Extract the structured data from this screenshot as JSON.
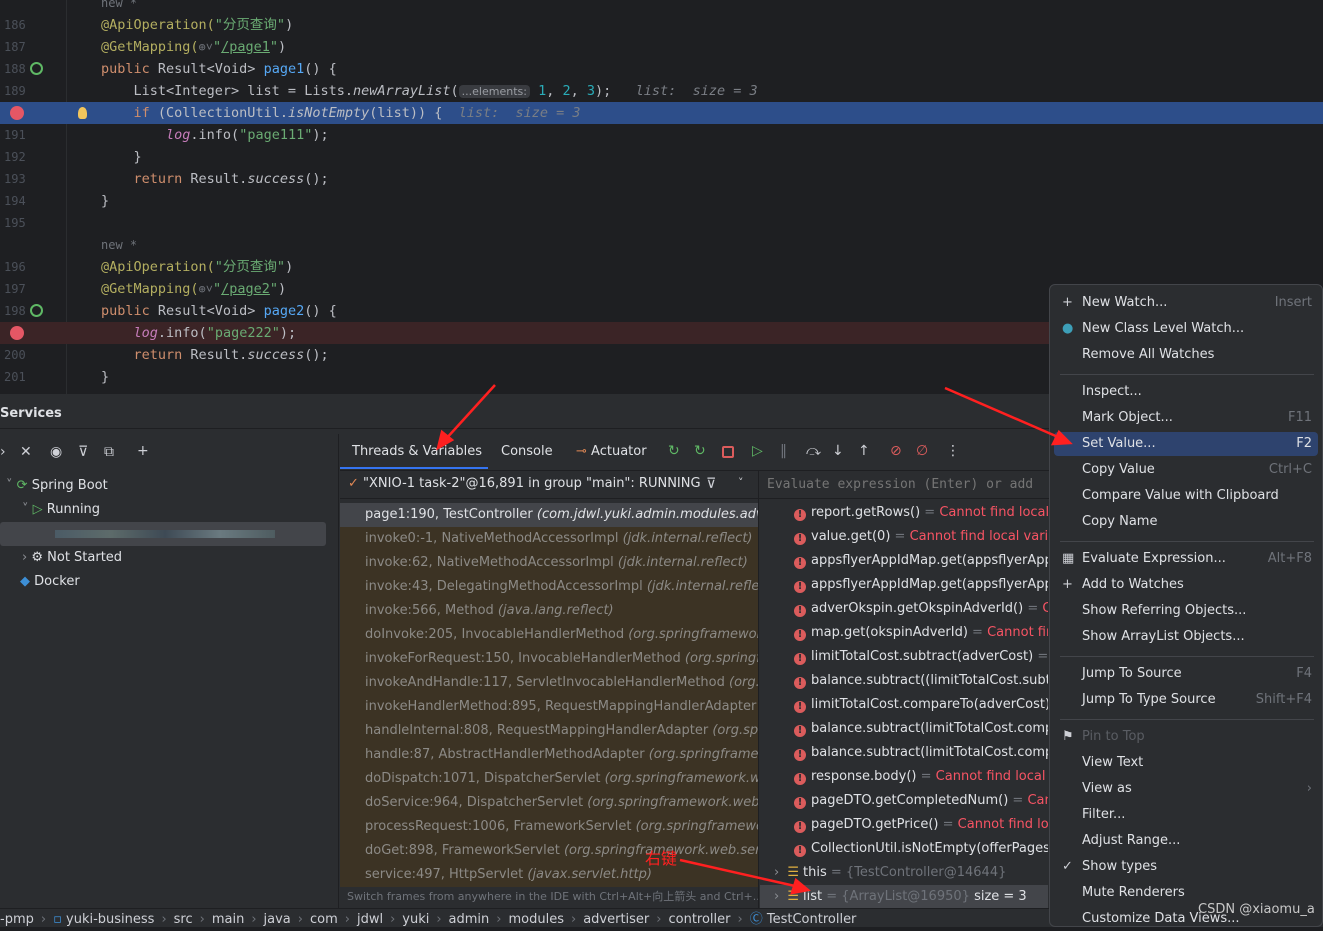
{
  "editor": {
    "lines": [
      {
        "n": "",
        "cls": "",
        "tokens": [
          {
            "t": "new *",
            "c": "g"
          }
        ]
      },
      {
        "n": "186",
        "cls": "",
        "tokens": [
          {
            "t": "@ApiOperation(",
            "c": "a"
          },
          {
            "t": "\"分页查询\"",
            "c": "s"
          },
          {
            "t": ")",
            "c": "t"
          }
        ]
      },
      {
        "n": "187",
        "cls": "",
        "tokens": [
          {
            "t": "@GetMapping(",
            "c": "a"
          },
          {
            "t": "⊕˅",
            "c": "g"
          },
          {
            "t": "\"",
            "c": "s"
          },
          {
            "t": "/page1",
            "c": "u"
          },
          {
            "t": "\"",
            "c": "s"
          },
          {
            "t": ")",
            "c": "t"
          }
        ]
      },
      {
        "n": "188",
        "cls": "spring",
        "tokens": [
          {
            "t": "public ",
            "c": "k"
          },
          {
            "t": "Result<Void> ",
            "c": "t"
          },
          {
            "t": "page1",
            "c": "f"
          },
          {
            "t": "() {",
            "c": "t"
          }
        ]
      },
      {
        "n": "189",
        "cls": "",
        "tokens": [
          {
            "t": "    List<Integer> list = Lists.",
            "c": "t"
          },
          {
            "t": "newArrayList",
            "c": "t i"
          },
          {
            "t": "(",
            "c": "t"
          },
          {
            "t": "...elements:",
            "c": "hint"
          },
          {
            "t": " 1",
            "c": "n"
          },
          {
            "t": ", ",
            "c": "t"
          },
          {
            "t": "2",
            "c": "n"
          },
          {
            "t": ", ",
            "c": "t"
          },
          {
            "t": "3",
            "c": "n"
          },
          {
            "t": ");   ",
            "c": "t"
          },
          {
            "t": "list:  size = 3",
            "c": "h"
          }
        ]
      },
      {
        "n": "",
        "cls": "hl",
        "tokens": [
          {
            "t": "    if ",
            "c": "k"
          },
          {
            "t": "(CollectionUtil.",
            "c": "t"
          },
          {
            "t": "isNotEmpty",
            "c": "t i"
          },
          {
            "t": "(list)) {  ",
            "c": "t"
          },
          {
            "t": "list:  size = 3",
            "c": "h"
          }
        ]
      },
      {
        "n": "191",
        "cls": "",
        "tokens": [
          {
            "t": "        ",
            "c": "t"
          },
          {
            "t": "log",
            "c": "m i"
          },
          {
            "t": ".info(",
            "c": "t"
          },
          {
            "t": "\"page111\"",
            "c": "s"
          },
          {
            "t": ");",
            "c": "t"
          }
        ]
      },
      {
        "n": "192",
        "cls": "",
        "tokens": [
          {
            "t": "    }",
            "c": "t"
          }
        ]
      },
      {
        "n": "193",
        "cls": "",
        "tokens": [
          {
            "t": "    return ",
            "c": "k"
          },
          {
            "t": "Result.",
            "c": "t"
          },
          {
            "t": "success",
            "c": "t i"
          },
          {
            "t": "();",
            "c": "t"
          }
        ]
      },
      {
        "n": "194",
        "cls": "",
        "tokens": [
          {
            "t": "}",
            "c": "t"
          }
        ]
      },
      {
        "n": "195",
        "cls": "",
        "tokens": []
      },
      {
        "n": "",
        "cls": "",
        "tokens": [
          {
            "t": "new *",
            "c": "g"
          }
        ]
      },
      {
        "n": "196",
        "cls": "",
        "tokens": [
          {
            "t": "@ApiOperation(",
            "c": "a"
          },
          {
            "t": "\"分页查询\"",
            "c": "s"
          },
          {
            "t": ")",
            "c": "t"
          }
        ]
      },
      {
        "n": "197",
        "cls": "",
        "tokens": [
          {
            "t": "@GetMapping(",
            "c": "a"
          },
          {
            "t": "⊕˅",
            "c": "g"
          },
          {
            "t": "\"",
            "c": "s"
          },
          {
            "t": "/page2",
            "c": "u"
          },
          {
            "t": "\"",
            "c": "s"
          },
          {
            "t": ")",
            "c": "t"
          }
        ]
      },
      {
        "n": "198",
        "cls": "spring",
        "tokens": [
          {
            "t": "public ",
            "c": "k"
          },
          {
            "t": "Result<Void> ",
            "c": "t"
          },
          {
            "t": "page2",
            "c": "f"
          },
          {
            "t": "() {",
            "c": "t"
          }
        ]
      },
      {
        "n": "",
        "cls": "bp",
        "tokens": [
          {
            "t": "    ",
            "c": "t"
          },
          {
            "t": "log",
            "c": "m i"
          },
          {
            "t": ".info(",
            "c": "t"
          },
          {
            "t": "\"page222\"",
            "c": "s"
          },
          {
            "t": ");",
            "c": "t"
          }
        ]
      },
      {
        "n": "200",
        "cls": "",
        "tokens": [
          {
            "t": "    return ",
            "c": "k"
          },
          {
            "t": "Result.",
            "c": "t"
          },
          {
            "t": "success",
            "c": "t i"
          },
          {
            "t": "();",
            "c": "t"
          }
        ]
      },
      {
        "n": "201",
        "cls": "",
        "tokens": [
          {
            "t": "}",
            "c": "t"
          }
        ]
      }
    ]
  },
  "services": {
    "title": "Services",
    "tree": {
      "spring_boot": "Spring Boot",
      "running": "Running",
      "not_started": "Not Started",
      "docker": "Docker"
    }
  },
  "debug": {
    "tabs": {
      "threads": "Threads & Variables",
      "console": "Console",
      "actuator": "Actuator"
    },
    "thread": "\"XNIO-1 task-2\"@16,891 in group \"main\": RUNNING",
    "eval_placeholder": "Evaluate expression (Enter) or add",
    "frames": [
      {
        "m": "page1:190, TestController ",
        "p": "(com.jdwl.yuki.admin.modules.advertiser.controller)"
      },
      {
        "m": "invoke0:-1, NativeMethodAccessorImpl ",
        "p": "(jdk.internal.reflect)"
      },
      {
        "m": "invoke:62, NativeMethodAccessorImpl ",
        "p": "(jdk.internal.reflect)"
      },
      {
        "m": "invoke:43, DelegatingMethodAccessorImpl ",
        "p": "(jdk.internal.reflect)"
      },
      {
        "m": "invoke:566, Method ",
        "p": "(java.lang.reflect)"
      },
      {
        "m": "doInvoke:205, InvocableHandlerMethod ",
        "p": "(org.springframework.web.method.support)"
      },
      {
        "m": "invokeForRequest:150, InvocableHandlerMethod ",
        "p": "(org.springframework.web.method.support)"
      },
      {
        "m": "invokeAndHandle:117, ServletInvocableHandlerMethod ",
        "p": "(org.springframework)"
      },
      {
        "m": "invokeHandlerMethod:895, RequestMappingHandlerAdapter ",
        "p": "(org.springframework)"
      },
      {
        "m": "handleInternal:808, RequestMappingHandlerAdapter ",
        "p": "(org.springframework)"
      },
      {
        "m": "handle:87, AbstractHandlerMethodAdapter ",
        "p": "(org.springframework.web)"
      },
      {
        "m": "doDispatch:1071, DispatcherServlet ",
        "p": "(org.springframework.web.servlet)"
      },
      {
        "m": "doService:964, DispatcherServlet ",
        "p": "(org.springframework.web.servlet)"
      },
      {
        "m": "processRequest:1006, FrameworkServlet ",
        "p": "(org.springframework.web.servlet)"
      },
      {
        "m": "doGet:898, FrameworkServlet ",
        "p": "(org.springframework.web.servlet)"
      },
      {
        "m": "service:497, HttpServlet ",
        "p": "(javax.servlet.http)"
      }
    ],
    "frames_hint": "Switch frames from anywhere in the IDE with Ctrl+Alt+向上箭头 and Ctrl+...",
    "watches": [
      {
        "e": "report.getRows()",
        "v": "Cannot find local variable"
      },
      {
        "e": "value.get(0)",
        "v": "Cannot find local variable"
      },
      {
        "e": "appsflyerAppIdMap.get(appsflyerAppId)",
        "v": ""
      },
      {
        "e": "appsflyerAppIdMap.get(appsflyerAppId)",
        "v": ""
      },
      {
        "e": "adverOkspin.getOkspinAdverId()",
        "v": "Cannot find local variable"
      },
      {
        "e": "map.get(okspinAdverId)",
        "v": "Cannot find local variable"
      },
      {
        "e": "limitTotalCost.subtract(adverCost)",
        "v": "Cannot find local variable"
      },
      {
        "e": "balance.subtract((limitTotalCost.subtract",
        "v": ""
      },
      {
        "e": "limitTotalCost.compareTo(adverCost)",
        "v": "Cannot find local variable"
      },
      {
        "e": "balance.subtract(limitTotalCost.compareTo",
        "v": ""
      },
      {
        "e": "balance.subtract(limitTotalCost.compareTo",
        "v": ""
      },
      {
        "e": "response.body()",
        "v": "Cannot find local variable"
      },
      {
        "e": "pageDTO.getCompletedNum()",
        "v": "Cannot find local variable"
      },
      {
        "e": "pageDTO.getPrice()",
        "v": "Cannot find local variable"
      },
      {
        "e": "CollectionUtil.isNotEmpty(offerPages)",
        "v": ""
      }
    ],
    "vars": [
      {
        "name": "this",
        "val": "{TestController@14644}",
        "extra": ""
      },
      {
        "name": "list",
        "val": "{ArrayList@16950}",
        "extra": "size = 3"
      }
    ]
  },
  "menu": {
    "groups": [
      [
        {
          "l": "New Watch...",
          "s": "Insert",
          "ic": "plus"
        },
        {
          "l": "New Class Level Watch...",
          "s": "",
          "ic": "class-watch"
        },
        {
          "l": "Remove All Watches",
          "s": ""
        }
      ],
      [
        {
          "l": "Inspect...",
          "s": ""
        },
        {
          "l": "Mark Object...",
          "s": "F11"
        },
        {
          "l": "Set Value...",
          "s": "F2",
          "active": true
        },
        {
          "l": "Copy Value",
          "s": "Ctrl+C"
        },
        {
          "l": "Compare Value with Clipboard",
          "s": ""
        },
        {
          "l": "Copy Name",
          "s": ""
        }
      ],
      [
        {
          "l": "Evaluate Expression...",
          "s": "Alt+F8",
          "ic": "calculator"
        },
        {
          "l": "Add to Watches",
          "s": "",
          "ic": "add-watch"
        },
        {
          "l": "Show Referring Objects...",
          "s": ""
        },
        {
          "l": "Show ArrayList Objects...",
          "s": ""
        }
      ],
      [
        {
          "l": "Jump To Source",
          "s": "F4"
        },
        {
          "l": "Jump To Type Source",
          "s": "Shift+F4"
        }
      ],
      [
        {
          "l": "Pin to Top",
          "s": "",
          "ic": "flag",
          "disabled": true
        },
        {
          "l": "View Text",
          "s": ""
        },
        {
          "l": "View as",
          "s": "›"
        },
        {
          "l": "Filter...",
          "s": ""
        },
        {
          "l": "Adjust Range...",
          "s": ""
        },
        {
          "l": "Show types",
          "s": "",
          "ic": "check"
        },
        {
          "l": "Mute Renderers",
          "s": ""
        },
        {
          "l": "Customize Data Views...",
          "s": ""
        }
      ]
    ]
  },
  "breadcrumbs": [
    "-pmp",
    "yuki-business",
    "src",
    "main",
    "java",
    "com",
    "jdwl",
    "yuki",
    "admin",
    "modules",
    "advertiser",
    "controller",
    "TestController"
  ],
  "annotation": {
    "right_click": "右键",
    "watermark": "CSDN @xiaomu_a"
  },
  "colors": {
    "accent": "#2e436e",
    "error": "#f75464",
    "annotation": "#ff2020"
  }
}
